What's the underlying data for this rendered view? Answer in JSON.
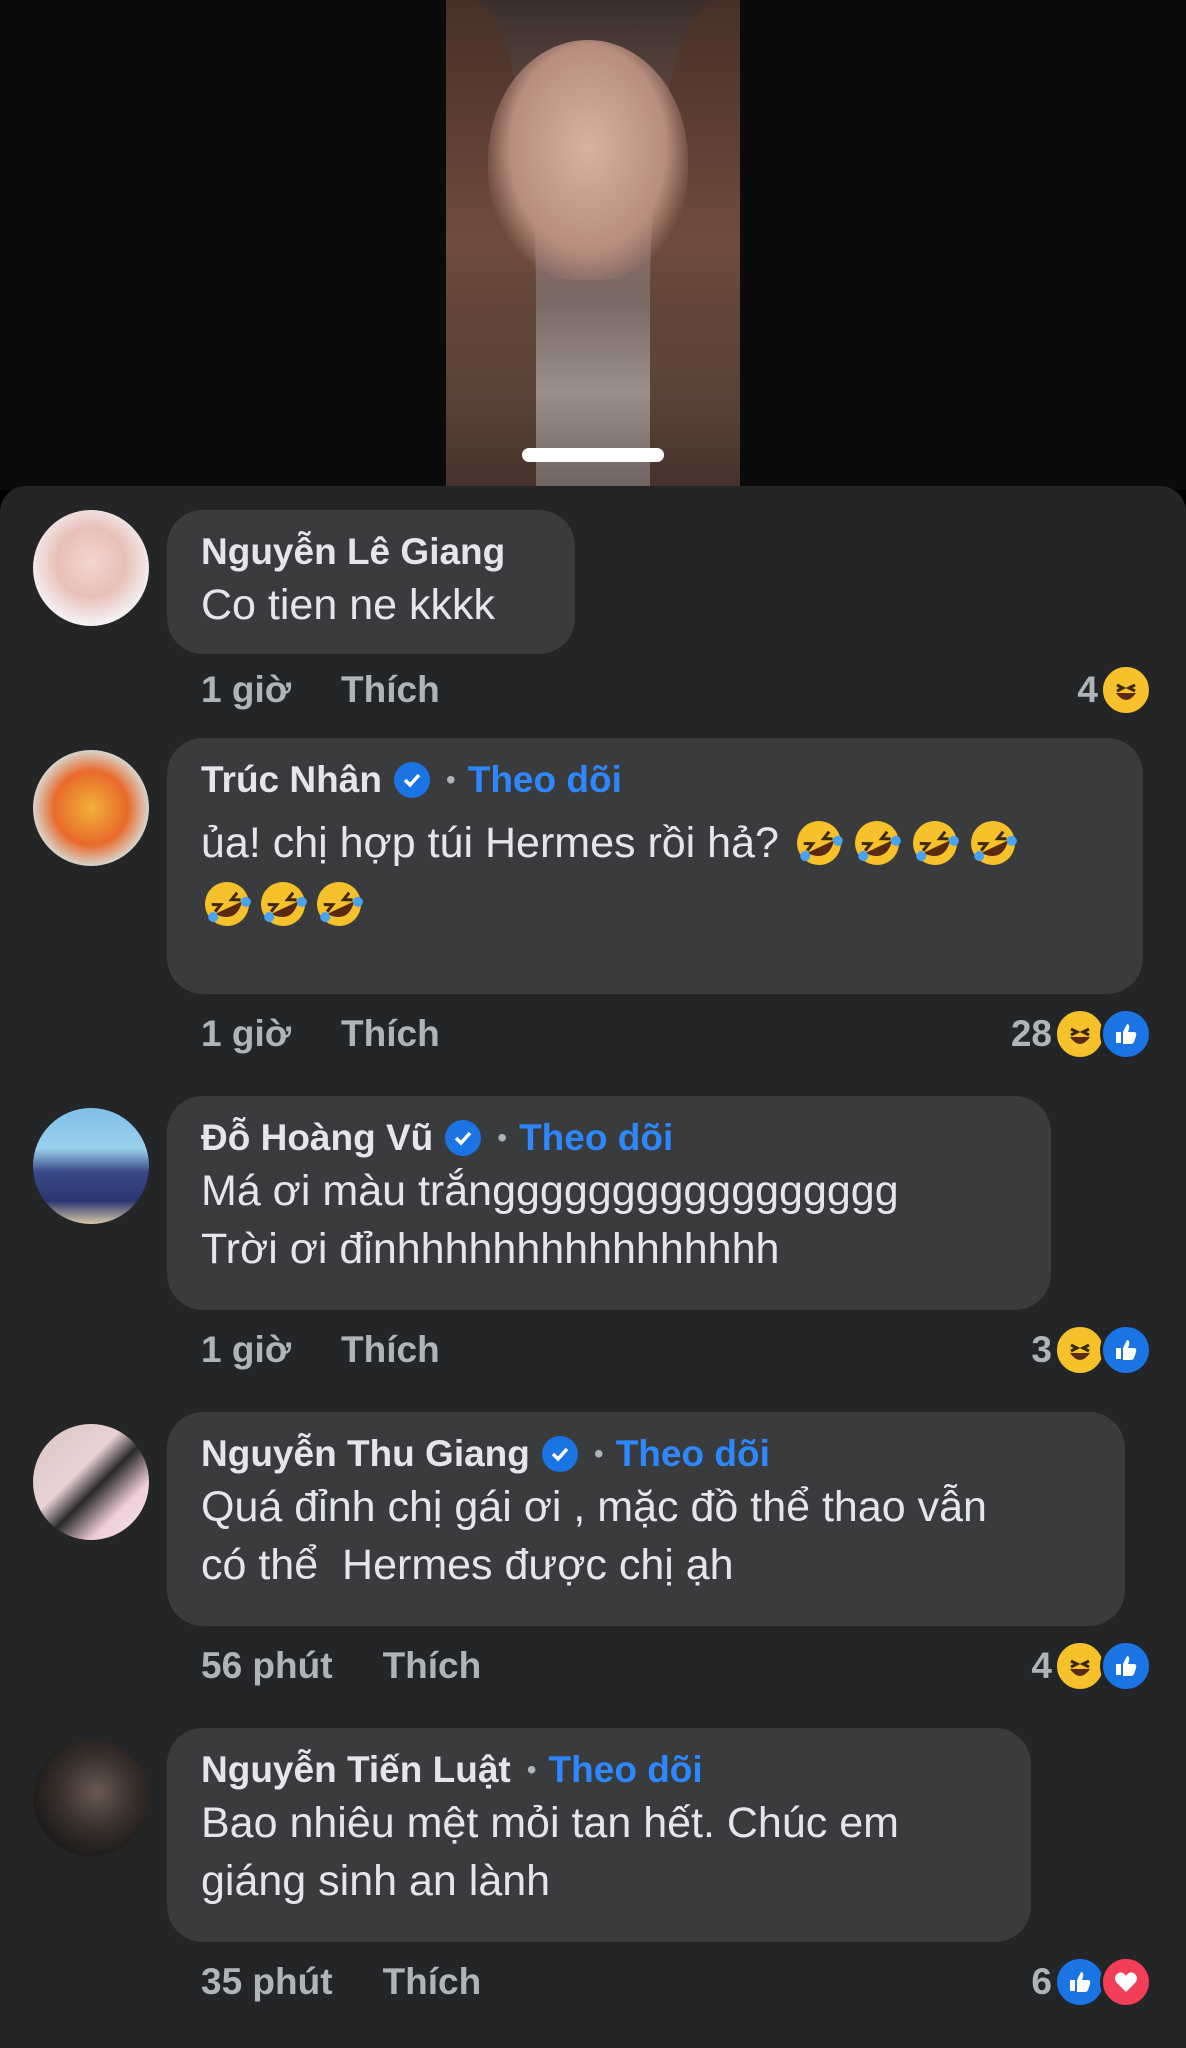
{
  "comments": [
    {
      "name": "Nguyễn Lê Giang",
      "verified": false,
      "follow": "",
      "text_lines": [
        "Co tien ne kkkk"
      ],
      "emoji_count": 0,
      "time": "1 giờ",
      "like_label": "Thích",
      "reaction_count": "4",
      "reactions": [
        "haha"
      ]
    },
    {
      "name": "Trúc Nhân",
      "verified": true,
      "follow": "Theo dõi",
      "text_lines": [
        "ủa! chị hợp túi Hermes rồi hả?"
      ],
      "emoji_count": 7,
      "time": "1 giờ",
      "like_label": "Thích",
      "reaction_count": "28",
      "reactions": [
        "haha",
        "like"
      ]
    },
    {
      "name": "Đỗ Hoàng Vũ",
      "verified": true,
      "follow": "Theo dõi",
      "text_lines": [
        "Má ơi màu trắnggggggggggggggggg",
        "Trời ơi đỉnhhhhhhhhhhhhhhhh"
      ],
      "emoji_count": 0,
      "time": "1 giờ",
      "like_label": "Thích",
      "reaction_count": "3",
      "reactions": [
        "haha",
        "like"
      ]
    },
    {
      "name": "Nguyễn Thu Giang",
      "verified": true,
      "follow": "Theo dõi",
      "text_lines": [
        "Quá đỉnh chị gái ơi , mặc đồ thể thao vẫn",
        "có thể  Hermes được chị ạh"
      ],
      "emoji_count": 0,
      "time": "56 phút",
      "like_label": "Thích",
      "reaction_count": "4",
      "reactions": [
        "haha",
        "like"
      ]
    },
    {
      "name": "Nguyễn Tiến Luật",
      "verified": false,
      "follow": "Theo dõi",
      "text_lines": [
        "Bao nhiêu mệt mỏi tan hết. Chúc em",
        "giáng sinh an lành"
      ],
      "emoji_count": 0,
      "time": "35 phút",
      "like_label": "Thích",
      "reaction_count": "6",
      "reactions": [
        "like",
        "love"
      ]
    }
  ],
  "colors": {
    "sheet_bg": "#242526",
    "bubble_bg": "#3a3b3c",
    "text": "#e4e6eb",
    "muted": "#b0b3b8",
    "link": "#2d88ff",
    "verified": "#1b74e4"
  }
}
